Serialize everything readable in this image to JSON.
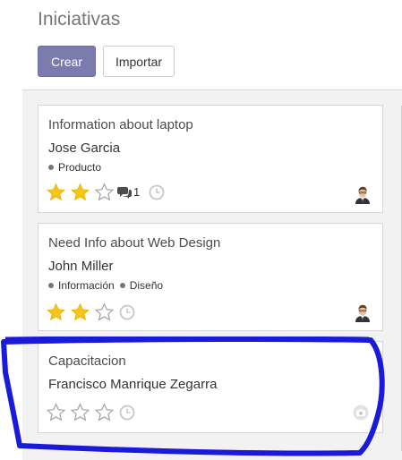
{
  "page": {
    "title": "Iniciativas",
    "create_label": "Crear",
    "import_label": "Importar"
  },
  "colors": {
    "primary": "#7c7bad",
    "star_filled": "#f5c518",
    "star_empty": "#b0b0b0",
    "annotation": "#1a1adb"
  },
  "cards": [
    {
      "title": "Information about laptop",
      "customer": "Jose Garcia",
      "tags": [
        "Producto"
      ],
      "rating": 2,
      "rating_max": 3,
      "messages": "1",
      "icons": [
        "star-icon",
        "comments-icon",
        "clock-icon",
        "avatar"
      ]
    },
    {
      "title": "Need Info about Web Design",
      "customer": "John Miller",
      "tags": [
        "Información",
        "Diseño"
      ],
      "rating": 2,
      "rating_max": 3,
      "icons": [
        "star-icon",
        "clock-icon",
        "avatar"
      ]
    },
    {
      "title": "Capacitacion",
      "customer": "Francisco Manrique Zegarra",
      "tags": [],
      "rating": 0,
      "rating_max": 3,
      "icons": [
        "star-icon",
        "clock-icon",
        "camera-icon"
      ]
    }
  ]
}
